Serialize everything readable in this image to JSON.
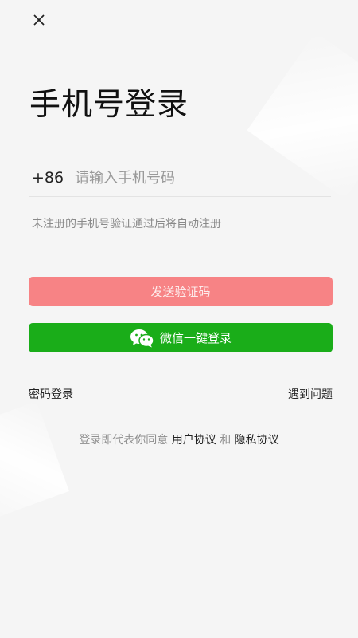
{
  "close_icon": "close-icon",
  "title": "手机号登录",
  "phone": {
    "country_code": "+86",
    "placeholder": "请输入手机号码",
    "value": ""
  },
  "hint": "未注册的手机号验证通过后将自动注册",
  "send_code_button": "发送验证码",
  "wechat_button": {
    "icon": "wechat-icon",
    "label": "微信一键登录"
  },
  "links": {
    "password_login": "密码登录",
    "problem": "遇到问题"
  },
  "agreement": {
    "prefix": "登录即代表你同意",
    "user_agreement": "用户协议",
    "and": "和",
    "privacy_policy": "隐私协议"
  },
  "colors": {
    "send_button_bg": "#f78385",
    "wechat_green": "#1aad19",
    "page_bg": "#f5f5f5"
  }
}
